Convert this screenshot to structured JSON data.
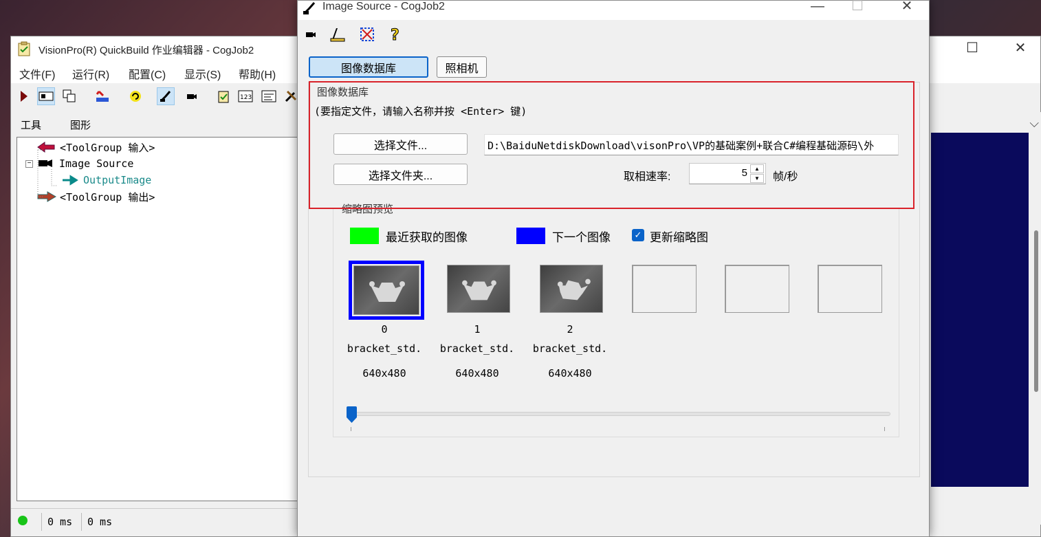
{
  "quickbuild": {
    "title": "VisionPro(R) QuickBuild 作业编辑器 - CogJob2",
    "menu": [
      "文件(F)",
      "运行(R)",
      "配置(C)",
      "显示(S)",
      "帮助(H)"
    ],
    "tabs": [
      "工具",
      "图形"
    ],
    "tree": {
      "input": "<ToolGroup 输入>",
      "image_source": "Image Source",
      "output_image": "OutputImage",
      "output": "<ToolGroup 输出>"
    },
    "status": {
      "time1": "0 ms",
      "time2": "0 ms",
      "indicator_color": "#18c418"
    }
  },
  "dialog": {
    "title": "Image Source - CogJob2",
    "tabs": {
      "database": "图像数据库",
      "camera": "照相机"
    },
    "group_database": "图像数据库",
    "hint": "(要指定文件，请输入名称并按 <Enter> 键)",
    "buttons": {
      "select_file": "选择文件...",
      "select_folder": "选择文件夹..."
    },
    "file_path": "D:\\BaiduNetdiskDownload\\visonPro\\VP的基础案例+联合C#编程基础源码\\外",
    "rate": {
      "label": "取相速率:",
      "value": "5",
      "unit": "帧/秒"
    },
    "thumbnail_preview": {
      "group_label": "缩略图预览",
      "legend_recent": "最近获取的图像",
      "legend_recent_color": "#00ff00",
      "legend_next": "下一个图像",
      "legend_next_color": "#0000ff",
      "update_checkbox": {
        "label": "更新缩略图",
        "checked": true
      },
      "thumbnails": [
        {
          "index": "0",
          "name": "bracket_std.",
          "size": "640x480",
          "selected": true
        },
        {
          "index": "1",
          "name": "bracket_std.",
          "size": "640x480",
          "selected": false
        },
        {
          "index": "2",
          "name": "bracket_std.",
          "size": "640x480",
          "selected": false
        }
      ],
      "empty_slots": 3,
      "slider_value": 0
    }
  },
  "highlight_color": "#d9222a"
}
